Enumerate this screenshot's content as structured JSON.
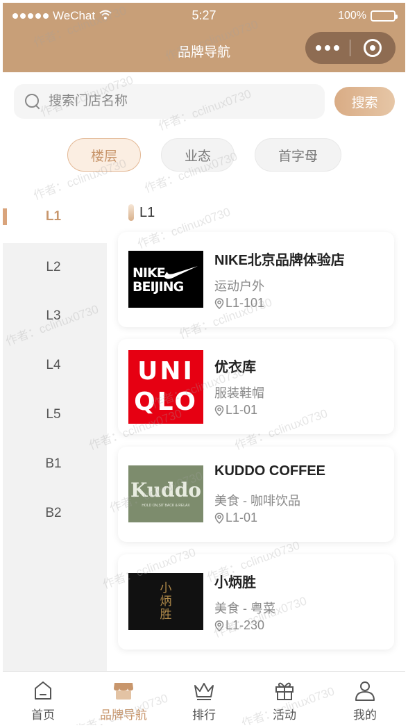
{
  "status_bar": {
    "carrier": "WeChat",
    "time": "5:27",
    "battery": "100%"
  },
  "nav": {
    "title": "品牌导航"
  },
  "search": {
    "placeholder": "搜索门店名称",
    "button": "搜索"
  },
  "filter_tabs": [
    {
      "label": "楼层",
      "active": true
    },
    {
      "label": "业态",
      "active": false
    },
    {
      "label": "首字母",
      "active": false
    }
  ],
  "floors": [
    {
      "label": "L1",
      "active": true
    },
    {
      "label": "L2",
      "active": false
    },
    {
      "label": "L3",
      "active": false
    },
    {
      "label": "L4",
      "active": false
    },
    {
      "label": "L5",
      "active": false
    },
    {
      "label": "B1",
      "active": false
    },
    {
      "label": "B2",
      "active": false
    }
  ],
  "section": {
    "title": "L1"
  },
  "shops": [
    {
      "name": "NIKE北京品牌体验店",
      "category": "运动户外",
      "location": "L1-101",
      "logo_text": [
        "NIKE",
        "BEIJING"
      ]
    },
    {
      "name": "优衣库",
      "category": "服装鞋帽",
      "location": "L1-01",
      "logo_text": [
        "UNI",
        "QLO"
      ]
    },
    {
      "name": "KUDDO COFFEE",
      "category": "美食 - 咖啡饮品",
      "location": "L1-01",
      "logo_text": [
        "Kuddo",
        "HOLD ON,SIT BACK & RELAX"
      ]
    },
    {
      "name": "小炳胜",
      "category": "美食 - 粤菜",
      "location": "L1-230",
      "logo_text": [
        "小",
        "炳",
        "胜"
      ]
    }
  ],
  "tabbar": [
    {
      "label": "首页",
      "icon": "home-icon",
      "active": false
    },
    {
      "label": "品牌导航",
      "icon": "store-icon",
      "active": true
    },
    {
      "label": "排行",
      "icon": "crown-icon",
      "active": false
    },
    {
      "label": "活动",
      "icon": "gift-icon",
      "active": false
    },
    {
      "label": "我的",
      "icon": "user-icon",
      "active": false
    }
  ],
  "watermark": "作者：cclinux0730",
  "colors": {
    "accent": "#c8966c",
    "nav_bg": "#c89f78",
    "capsule_bg": "#8e6c52"
  }
}
